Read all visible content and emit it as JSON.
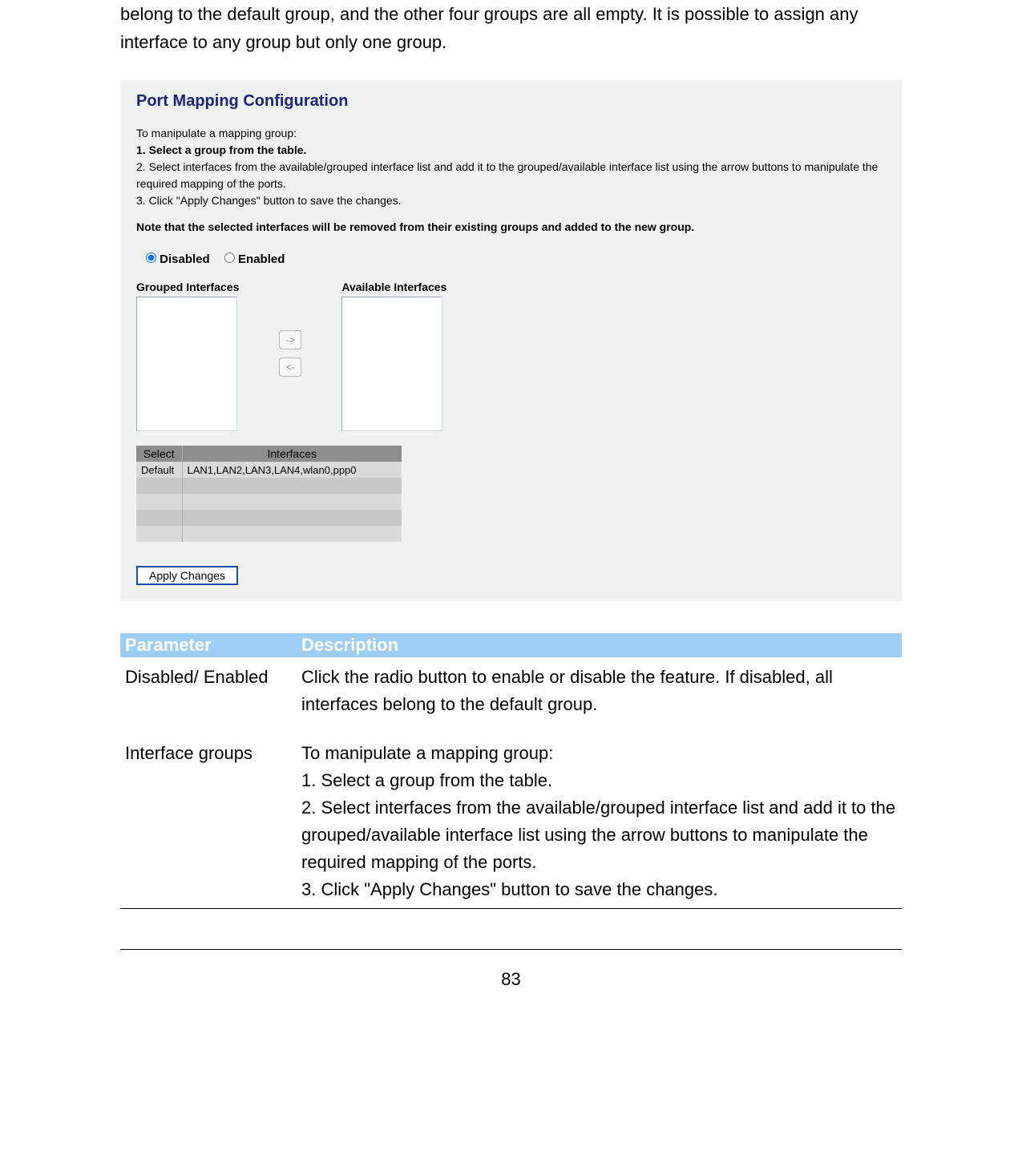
{
  "intro": "belong to the default group, and the other four groups are all empty. It is possible to assign any interface to any group but only one group.",
  "panel": {
    "title": "Port Mapping Configuration",
    "instr_lead": "To manipulate a mapping group:",
    "instr_1": "1. Select a group from the table.",
    "instr_2": "2. Select interfaces from the available/grouped interface list and add it to the grouped/available interface list using the arrow buttons to manipulate the required mapping of the ports.",
    "instr_3": "3. Click \"Apply Changes\" button to save the changes.",
    "note": "Note that the selected interfaces will be removed from their existing groups and added to the new group.",
    "radio_disabled": "Disabled",
    "radio_enabled": "Enabled",
    "grouped_label": "Grouped Interfaces",
    "available_label": "Available Interfaces",
    "arrow_right": "->",
    "arrow_left": "<-",
    "table_headers": {
      "select": "Select",
      "interfaces": "Interfaces"
    },
    "table_rows": [
      {
        "select": "Default",
        "interfaces": "LAN1,LAN2,LAN3,LAN4,wlan0,ppp0"
      },
      {
        "select": "",
        "interfaces": ""
      },
      {
        "select": "",
        "interfaces": ""
      },
      {
        "select": "",
        "interfaces": ""
      },
      {
        "select": "",
        "interfaces": ""
      }
    ],
    "apply_label": "Apply Changes"
  },
  "param_table": {
    "head_param": "Parameter",
    "head_desc": "Description",
    "rows": [
      {
        "param": "Disabled/ Enabled",
        "desc": "Click the radio button to enable or disable the feature. If disabled, all interfaces belong to the default group."
      },
      {
        "param": "Interface groups",
        "desc": "To manipulate a mapping group:\n1. Select a group from the table.\n2. Select interfaces from the available/grouped interface list and add it to the grouped/available interface list using the arrow buttons to manipulate the required mapping of the ports.\n3. Click \"Apply Changes\" button to save the changes."
      }
    ]
  },
  "page_number": "83"
}
